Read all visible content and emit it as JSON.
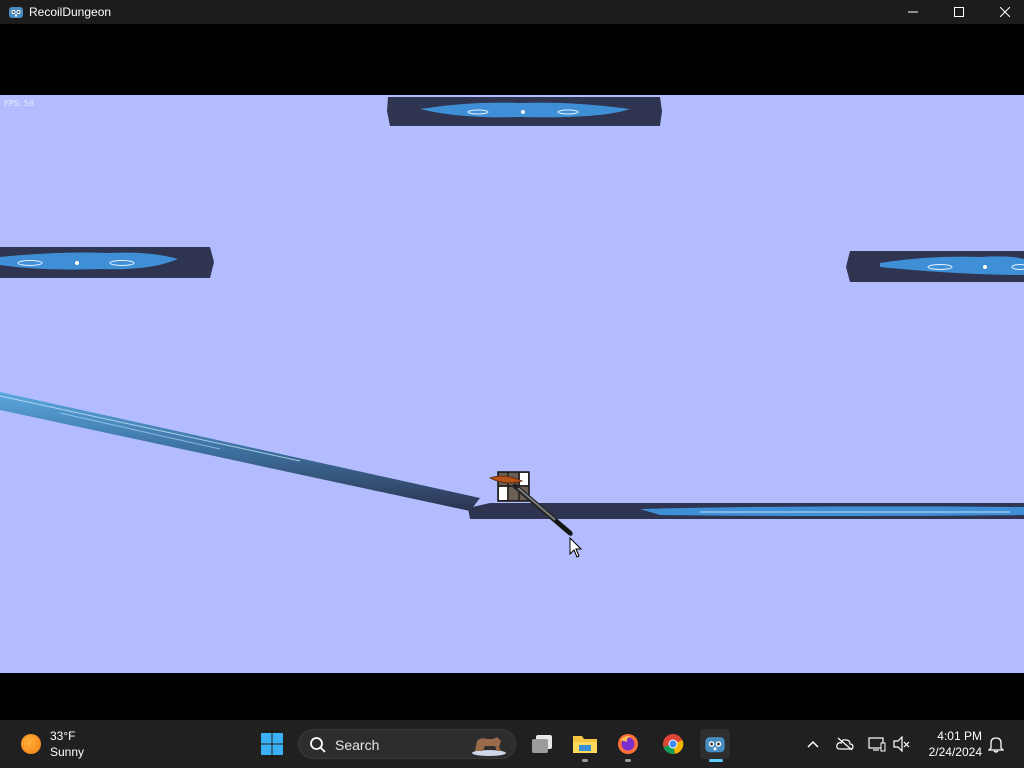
{
  "window": {
    "title": "RecoilDungeon",
    "controls": {
      "minimize_icon": "minimize-icon",
      "maximize_icon": "maximize-icon",
      "close_icon": "close-icon"
    }
  },
  "game": {
    "fps_label": "FPS: 58",
    "background_color": "#b3bcff",
    "platform_color": "#2f3450",
    "water_color": "#3f8fd6",
    "objects": [
      "floating-platform",
      "floating-platform",
      "floating-platform",
      "sloped-ramp",
      "ground-ledge",
      "player-character",
      "rifle",
      "mouse-cursor"
    ]
  },
  "taskbar": {
    "weather": {
      "temperature": "33°F",
      "condition": "Sunny",
      "icon": "sun-icon"
    },
    "search": {
      "label": "Search"
    },
    "apps": [
      {
        "name": "task-view",
        "icon": "task-view-icon"
      },
      {
        "name": "file-explorer",
        "icon": "folder-icon"
      },
      {
        "name": "firefox",
        "icon": "firefox-icon"
      },
      {
        "name": "chrome",
        "icon": "chrome-icon"
      },
      {
        "name": "godot",
        "icon": "godot-icon",
        "active": true
      }
    ],
    "tray": [
      "chevron-up-icon",
      "cloud-off-icon",
      "network-icon",
      "volume-muted-icon"
    ],
    "clock": {
      "time": "4:01 PM",
      "date": "2/24/2024"
    },
    "notification_icon": "bell-icon"
  }
}
